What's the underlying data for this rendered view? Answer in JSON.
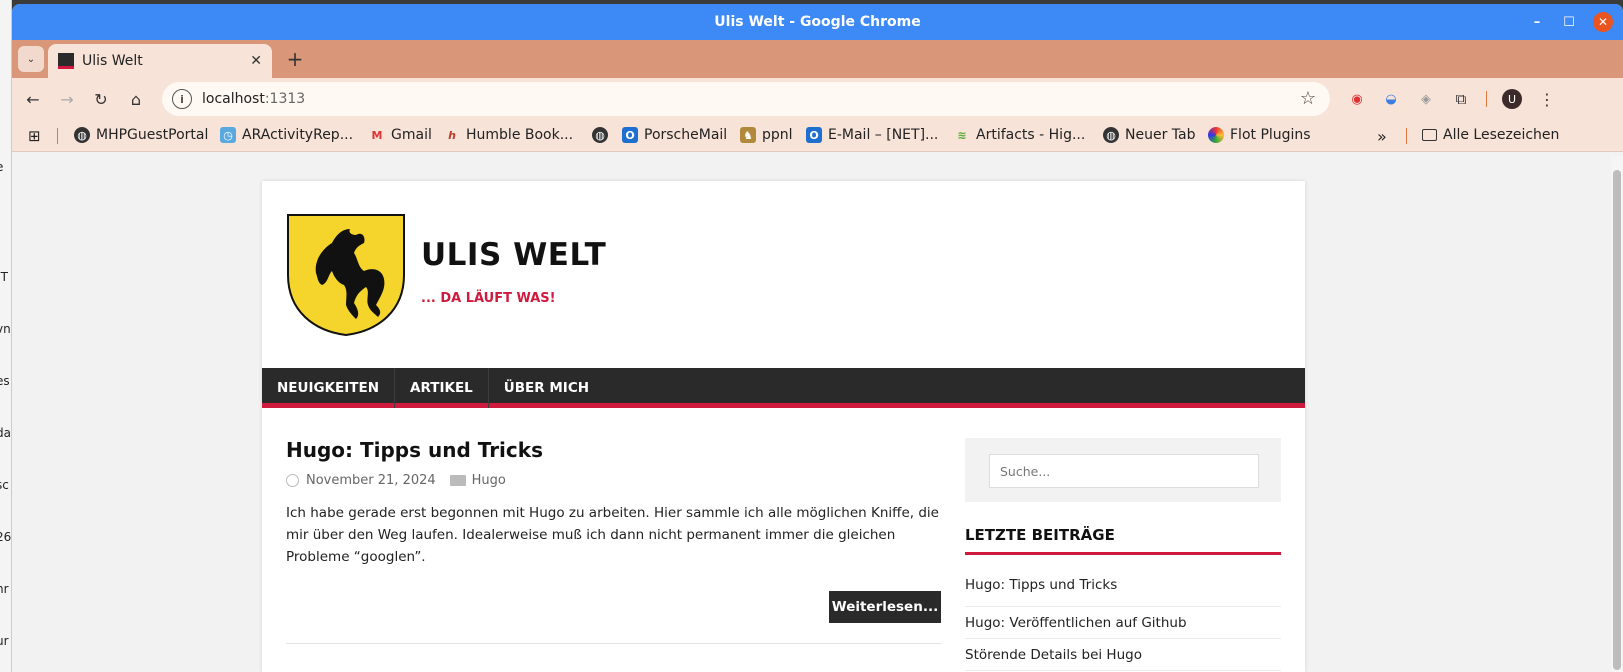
{
  "window": {
    "title": "Ulis Welt - Google Chrome"
  },
  "tab": {
    "title": "Ulis Welt"
  },
  "address": {
    "host": "localhost",
    "port": ":1313"
  },
  "bookmarks": [
    {
      "label": "MHPGuestPortal",
      "icon": "globe-icon"
    },
    {
      "label": "ARActivityRep...",
      "icon": "clock-icon"
    },
    {
      "label": "Gmail",
      "icon": "gmail-icon"
    },
    {
      "label": "Humble Book...",
      "icon": "humble-icon"
    },
    {
      "label": "",
      "icon": "globe-icon"
    },
    {
      "label": "PorscheMail",
      "icon": "outlook-icon"
    },
    {
      "label": "ppnl",
      "icon": "porsche-icon"
    },
    {
      "label": "E-Mail – [NET]...",
      "icon": "outlook-icon"
    },
    {
      "label": "Artifacts - Hig...",
      "icon": "artifacts-icon"
    },
    {
      "label": "Neuer Tab",
      "icon": "globe-icon"
    },
    {
      "label": "Flot Plugins",
      "icon": "flot-icon"
    }
  ],
  "all_bookmarks": "Alle Lesezeichen",
  "site": {
    "title": "ULIS WELT",
    "tagline": "... DA LÄUFT WAS!",
    "nav": [
      "NEUIGKEITEN",
      "ARTIKEL",
      "ÜBER MICH"
    ]
  },
  "post": {
    "title": "Hugo: Tipps und Tricks",
    "date": "November 21, 2024",
    "category": "Hugo",
    "excerpt": "Ich habe gerade erst begonnen mit Hugo zu arbeiten. Hier sammle ich alle möglichen Kniffe, die mir über den Weg laufen. Idealerweise muß ich dann nicht permanent immer die gleichen Probleme “googlen”.",
    "more": "Weiterlesen..."
  },
  "sidebar": {
    "search_placeholder": "Suche...",
    "recent_title": "LETZTE BEITRÄGE",
    "recent": [
      "Hugo: Tipps und Tricks",
      "Hugo: Veröffentlichen auf Github",
      "Störende Details bei Hugo"
    ]
  },
  "colors": {
    "accent": "#cf1a3e",
    "chrome_title": "#3d8af7",
    "tab_strip": "#d99679"
  }
}
